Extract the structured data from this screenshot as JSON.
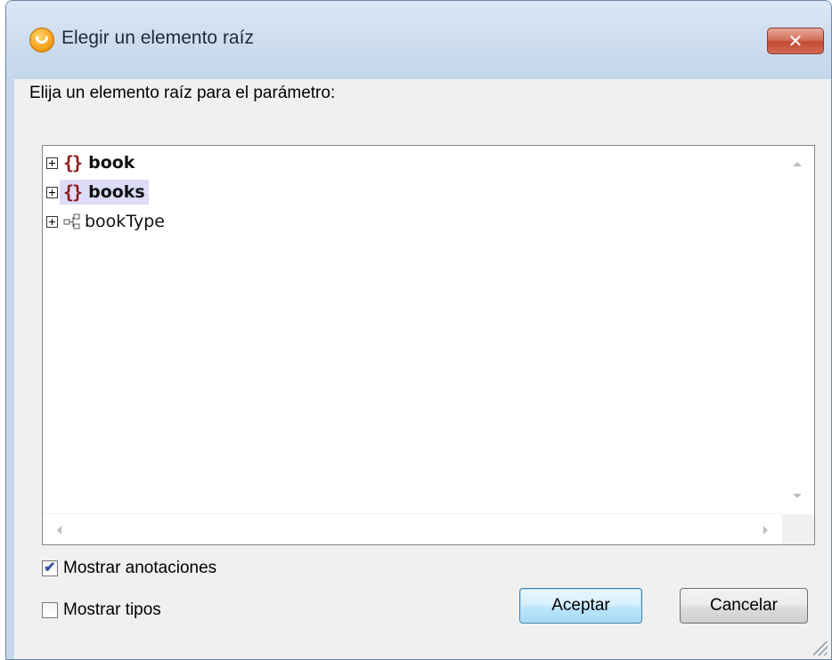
{
  "window": {
    "title": "Elegir un elemento raíz",
    "close_glyph": "✕"
  },
  "prompt": "Elija un elemento raíz para el parámetro:",
  "tree": {
    "items": [
      {
        "label": "book",
        "icon": "element-braces-icon",
        "bold": true,
        "selected": false
      },
      {
        "label": "books",
        "icon": "element-braces-icon",
        "bold": true,
        "selected": true
      },
      {
        "label": "bookType",
        "icon": "complex-type-icon",
        "bold": false,
        "selected": false
      }
    ],
    "brace_glyph": "{}"
  },
  "options": {
    "show_annotations": {
      "label": "Mostrar anotaciones",
      "checked": true,
      "check_glyph": "✔"
    },
    "show_types": {
      "label": "Mostrar tipos",
      "checked": false
    }
  },
  "buttons": {
    "ok": "Aceptar",
    "cancel": "Cancelar"
  },
  "colors": {
    "accent_element": "#8b1a1a",
    "selection": "#dcdcf8",
    "default_button_border": "#3c7fb1",
    "close_button": "#c24a33"
  }
}
